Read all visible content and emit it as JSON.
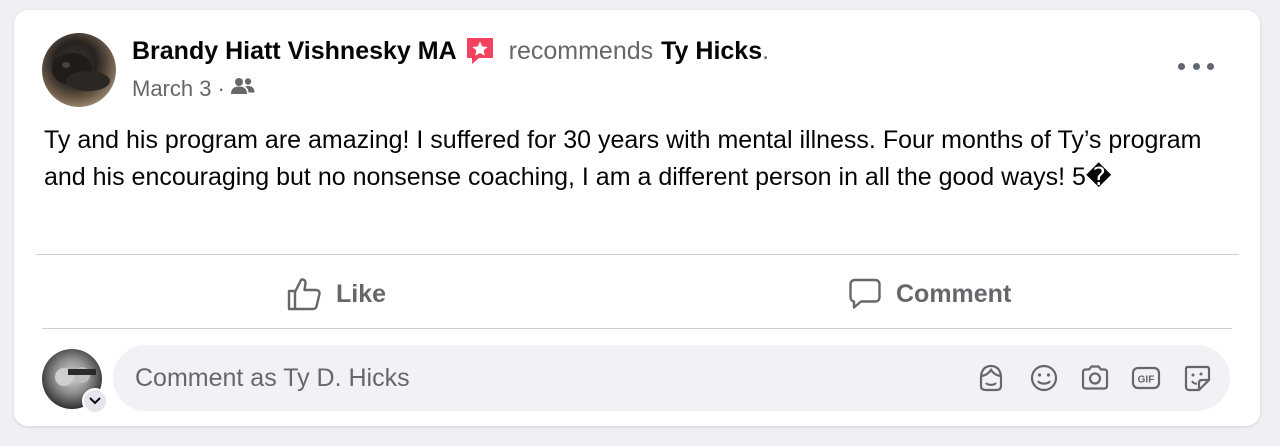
{
  "post": {
    "author": "Brandy Hiatt Vishnesky MA",
    "recommends_text": "recommends",
    "page_name": "Ty Hicks",
    "period": ".",
    "date": "March 3",
    "separator": "·",
    "audience_icon": "friends-icon",
    "body": "Ty and his program are amazing! I suffered for 30 years with mental illness. Four months of Ty’s program and his encouraging but no nonsense coaching, I am a different person in all the good ways! 5�"
  },
  "actions": {
    "like_label": "Like",
    "comment_label": "Comment"
  },
  "comment_input": {
    "placeholder": "Comment as Ty D. Hicks",
    "icons": [
      "avatar-sticker-icon",
      "emoji-icon",
      "camera-icon",
      "gif-icon",
      "sticker-icon"
    ]
  },
  "colors": {
    "badge": "#f3425f",
    "text_secondary": "#65676b",
    "input_bg": "#f0f2f5"
  }
}
